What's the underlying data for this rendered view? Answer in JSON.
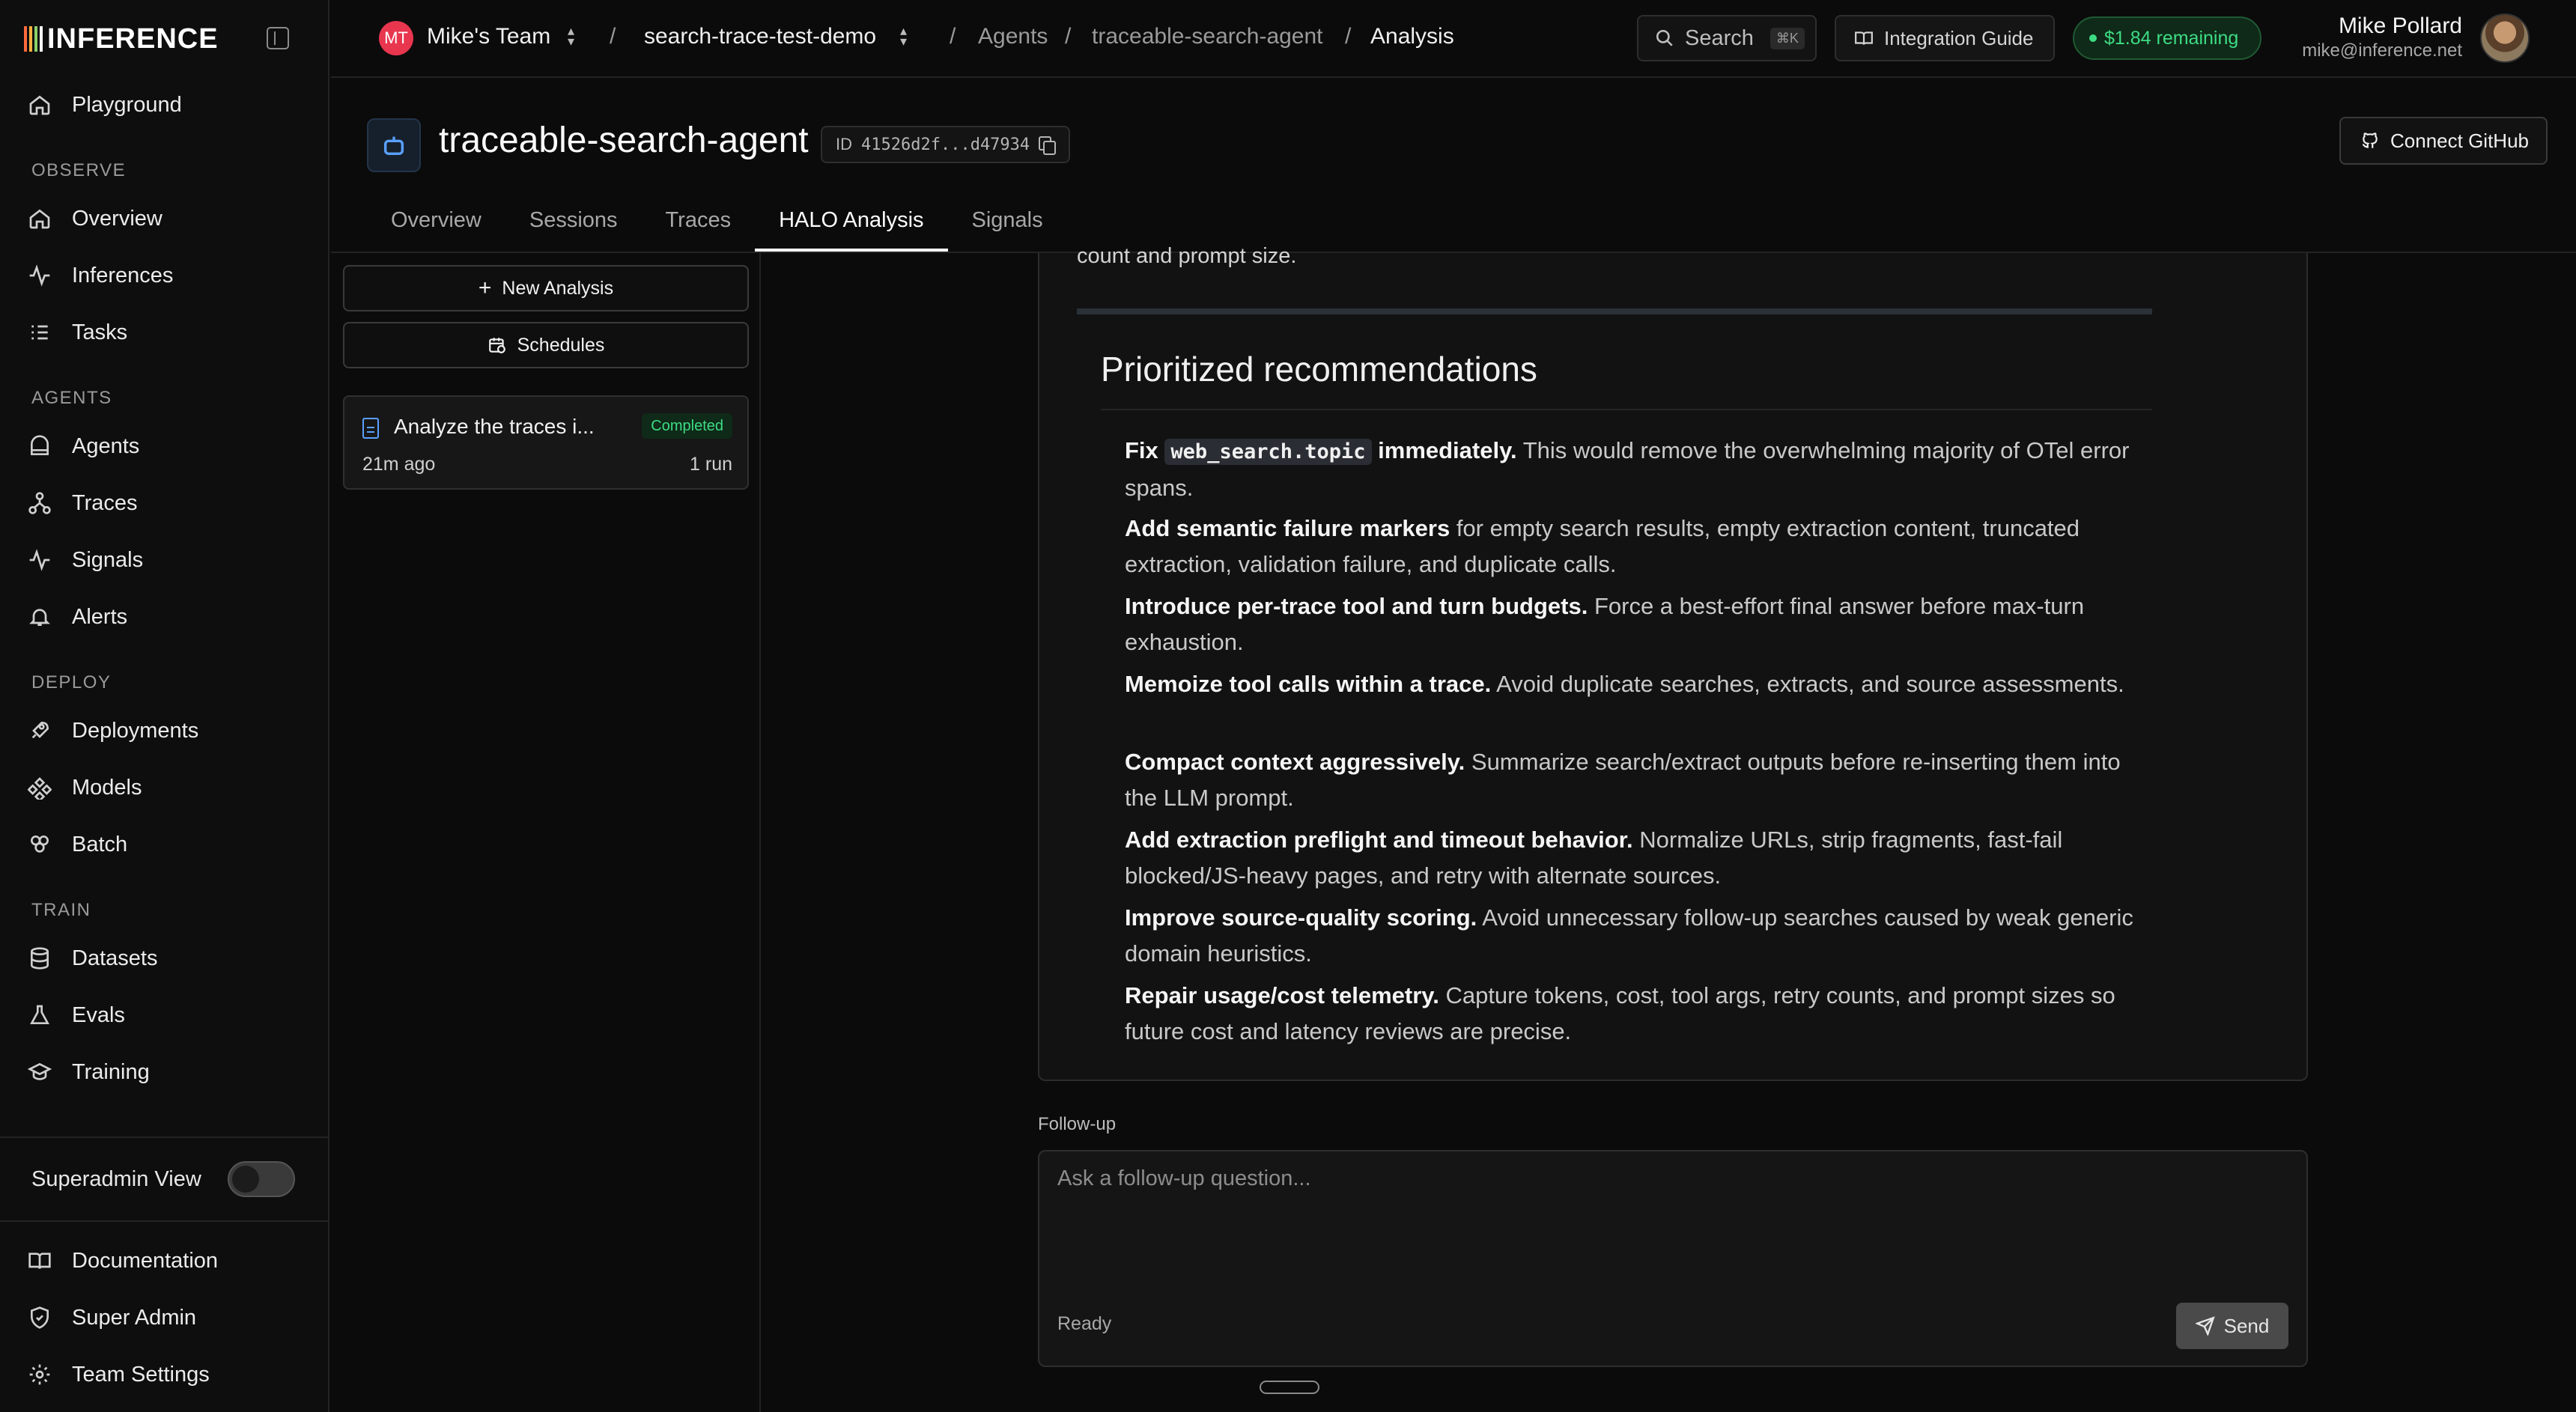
{
  "logo": {
    "text": "INFERENCE"
  },
  "sidebar": {
    "top_item": {
      "label": "Playground",
      "icon": "home-icon"
    },
    "sections": [
      {
        "title": "OBSERVE",
        "items": [
          {
            "label": "Overview",
            "icon": "house-icon"
          },
          {
            "label": "Inferences",
            "icon": "activity-icon"
          },
          {
            "label": "Tasks",
            "icon": "list-icon"
          }
        ]
      },
      {
        "title": "AGENTS",
        "items": [
          {
            "label": "Agents",
            "icon": "bot-icon"
          },
          {
            "label": "Traces",
            "icon": "traces-icon"
          },
          {
            "label": "Signals",
            "icon": "activity-icon"
          },
          {
            "label": "Alerts",
            "icon": "bell-icon"
          }
        ]
      },
      {
        "title": "DEPLOY",
        "items": [
          {
            "label": "Deployments",
            "icon": "rocket-icon"
          },
          {
            "label": "Models",
            "icon": "models-icon"
          },
          {
            "label": "Batch",
            "icon": "batch-icon"
          }
        ]
      },
      {
        "title": "TRAIN",
        "items": [
          {
            "label": "Datasets",
            "icon": "database-icon"
          },
          {
            "label": "Evals",
            "icon": "flask-icon"
          },
          {
            "label": "Training",
            "icon": "graduation-cap-icon"
          }
        ]
      }
    ],
    "superadmin_label": "Superadmin View",
    "bottom_items": [
      {
        "label": "Documentation",
        "icon": "book-icon"
      },
      {
        "label": "Super Admin",
        "icon": "shield-icon"
      },
      {
        "label": "Team Settings",
        "icon": "gear-icon"
      }
    ]
  },
  "topbar": {
    "team_initials": "MT",
    "team_name": "Mike's Team",
    "project": "search-trace-test-demo",
    "breadcrumb": [
      "Agents",
      "traceable-search-agent",
      "Analysis"
    ],
    "search_label": "Search",
    "search_shortcut": "⌘K",
    "guide_label": "Integration Guide",
    "credits": "$1.84 remaining",
    "user_name": "Mike Pollard",
    "user_email": "mike@inference.net"
  },
  "header": {
    "title": "traceable-search-agent",
    "id_label": "ID",
    "id_value": "41526d2f...d47934",
    "github_label": "Connect GitHub"
  },
  "tabs": [
    "Overview",
    "Sessions",
    "Traces",
    "HALO Analysis",
    "Signals"
  ],
  "active_tab": "HALO Analysis",
  "analysis_panel": {
    "new_label": "New Analysis",
    "schedules_label": "Schedules",
    "card": {
      "title": "Analyze the traces i...",
      "status": "Completed",
      "time": "21m ago",
      "runs": "1 run"
    }
  },
  "report": {
    "cut_text": "count and prompt size.",
    "heading": "Prioritized recommendations",
    "items": [
      {
        "lead": "Fix",
        "code": "web_search.topic",
        "lead2": "immediately.",
        "text": "This would remove the overwhelming majority of OTel error spans."
      },
      {
        "lead": "Add semantic failure markers",
        "text": "for empty search results, empty extraction content, truncated extraction, validation failure, and duplicate calls."
      },
      {
        "lead": "Introduce per-trace tool and turn budgets.",
        "text": "Force a best-effort final answer before max-turn exhaustion."
      },
      {
        "lead": "Memoize tool calls within a trace.",
        "text": "Avoid duplicate searches, extracts, and source assessments."
      },
      {
        "lead": "Compact context aggressively.",
        "text": "Summarize search/extract outputs before re-inserting them into the LLM prompt."
      },
      {
        "lead": "Add extraction preflight and timeout behavior.",
        "text": "Normalize URLs, strip fragments, fast-fail blocked/JS-heavy pages, and retry with alternate sources."
      },
      {
        "lead": "Improve source-quality scoring.",
        "text": "Avoid unnecessary follow-up searches caused by weak generic domain heuristics."
      },
      {
        "lead": "Repair usage/cost telemetry.",
        "text": "Capture tokens, cost, tool args, retry counts, and prompt sizes so future cost and latency reviews are precise."
      }
    ]
  },
  "followup": {
    "label": "Follow-up",
    "placeholder": "Ask a follow-up question...",
    "status": "Ready",
    "send_label": "Send"
  }
}
